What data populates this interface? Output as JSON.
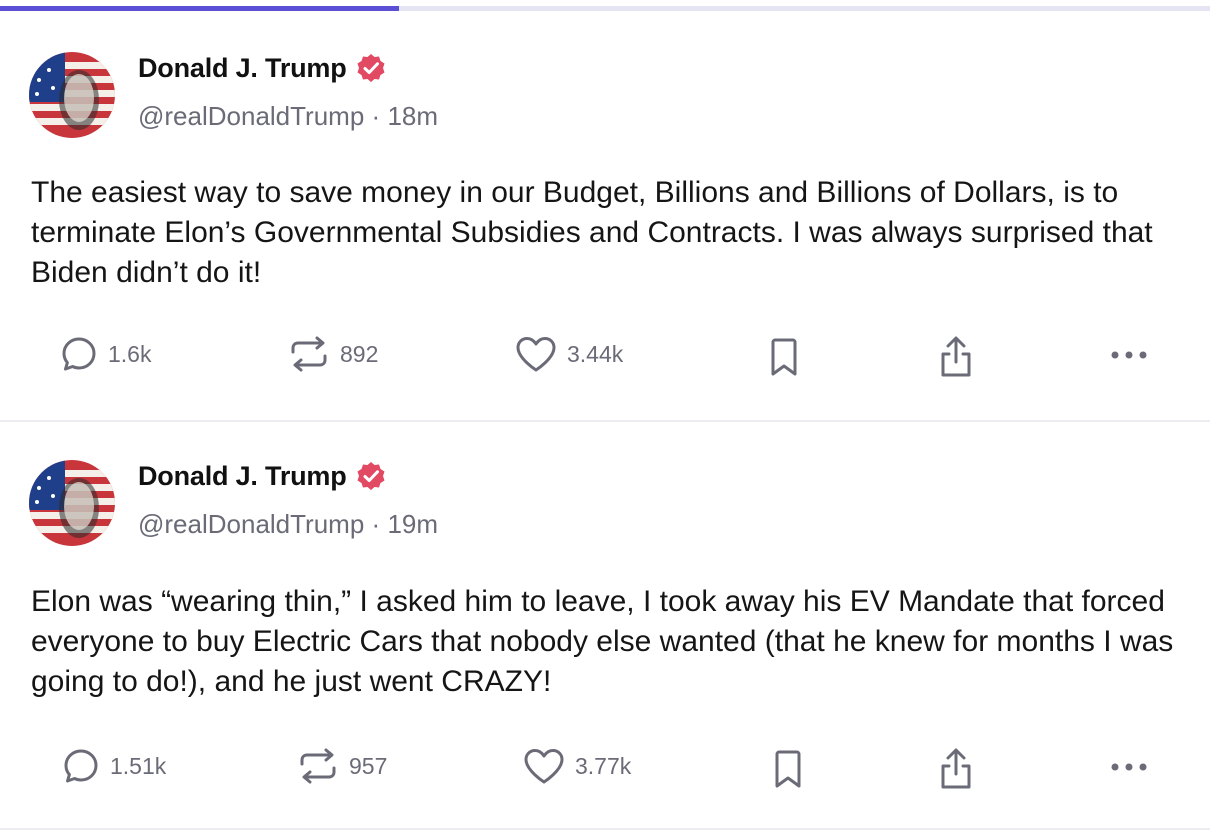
{
  "progress": {
    "fraction": 0.33,
    "fill_color": "#5b4fd6",
    "track_color": "#e4e4f2"
  },
  "posts": [
    {
      "author": "Donald J. Trump",
      "handle": "@realDonaldTrump",
      "separator": "·",
      "time": "18m",
      "text": "The easiest way to save money in our Budget, Billions and Billions of Dollars, is to terminate Elon’s Governmental Subsidies and Contracts. I was always surprised that Biden didn’t do it!",
      "replies": "1.6k",
      "reposts": "892",
      "likes": "3.44k"
    },
    {
      "author": "Donald J. Trump",
      "handle": "@realDonaldTrump",
      "separator": "·",
      "time": "19m",
      "text": "Elon was “wearing thin,” I asked him to leave, I took away his EV Mandate that forced everyone to buy Electric Cars that nobody else wanted (that he knew for months I was going to do!), and he just went CRAZY!",
      "replies": "1.51k",
      "reposts": "957",
      "likes": "3.77k"
    }
  ],
  "icons": {
    "verified": "verified-badge-icon",
    "reply": "speech-bubble-icon",
    "repost": "repost-arrows-icon",
    "like": "heart-icon",
    "bookmark": "bookmark-icon",
    "share": "share-upload-icon",
    "more": "more-dots-icon"
  },
  "colors": {
    "verified_badge": "#e24a63",
    "icon_gray": "#6b6b78",
    "text": "#151515"
  }
}
